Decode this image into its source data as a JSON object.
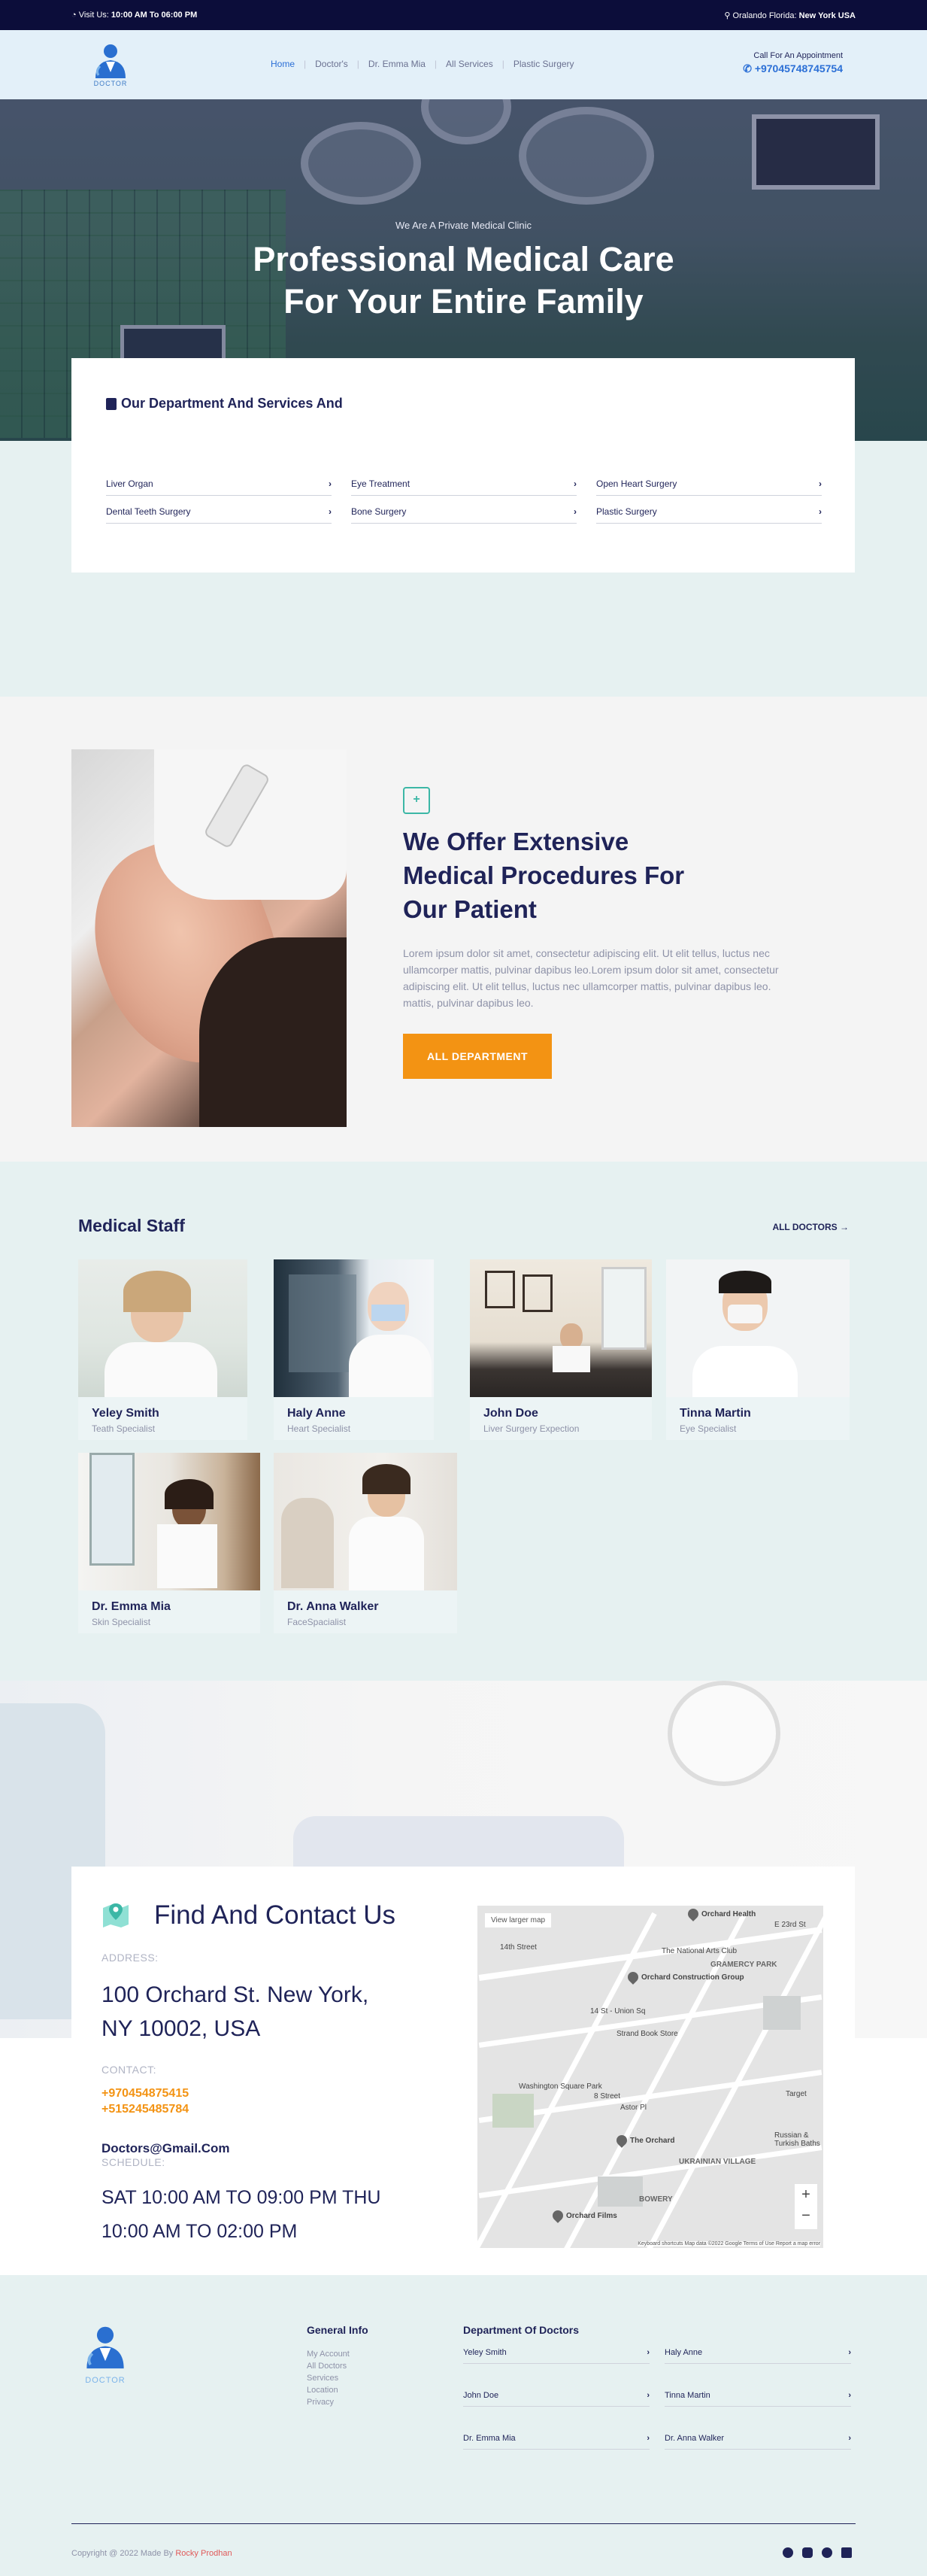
{
  "topbar": {
    "visit_label": "Visit Us:",
    "visit_hours": "10:00 AM To 06:00 PM",
    "location_label": "Oralando Florida:",
    "location_city": "New York USA"
  },
  "brand": {
    "logo_text": "DOCTOR"
  },
  "nav": {
    "items": [
      "Home",
      "Doctor's",
      "Dr. Emma Mia",
      "All Services",
      "Plastic Surgery"
    ]
  },
  "call": {
    "label": "Call For An Appointment",
    "phone": "+97045748745754"
  },
  "hero": {
    "subtitle": "We Are A Private Medical Clinic",
    "title_line1": "Professional Medical Care",
    "title_line2": "For Your Entire Family"
  },
  "departments": {
    "title": "Our Department And Services And",
    "items": [
      "Liver Organ",
      "Eye Treatment",
      "Open Heart Surgery",
      "Dental Teeth Surgery",
      "Bone Surgery",
      "Plastic Surgery"
    ]
  },
  "offer": {
    "title_line1": "We Offer Extensive",
    "title_line2": "Medical Procedures For",
    "title_line3": "Our Patient",
    "body": "Lorem ipsum dolor sit amet, consectetur adipiscing elit. Ut elit tellus, luctus nec ullamcorper mattis, pulvinar dapibus leo.Lorem ipsum dolor sit amet, consectetur adipiscing elit. Ut elit tellus, luctus nec ullamcorper mattis, pulvinar dapibus leo. mattis, pulvinar dapibus leo.",
    "button": "ALL DEPARTMENT"
  },
  "staff": {
    "title": "Medical Staff",
    "all_link": "ALL DOCTORS →",
    "members": [
      {
        "name": "Yeley Smith",
        "specialty": "Teath Specialist"
      },
      {
        "name": "Haly Anne",
        "specialty": "Heart Specialist"
      },
      {
        "name": "John Doe",
        "specialty": "Liver Surgery Expection"
      },
      {
        "name": "Tinna Martin",
        "specialty": "Eye Specialist"
      },
      {
        "name": "Dr. Emma Mia",
        "specialty": "Skin Specialist"
      },
      {
        "name": "Dr. Anna Walker",
        "specialty": "FaceSpacialist"
      }
    ]
  },
  "contact": {
    "title": "Find And Contact Us",
    "address_label": "ADDRESS:",
    "address_line1": "100 Orchard St. New York,",
    "address_line2": "NY 10002, USA",
    "contact_label": "CONTACT:",
    "phone1": "+970454875415",
    "phone2": "+515245485784",
    "email": "Doctors@Gmail.Com",
    "schedule_label": "SCHEDULE:",
    "schedule_line1": "SAT 10:00 AM TO 09:00 PM THU",
    "schedule_line2": "10:00 AM TO 02:00 PM"
  },
  "map": {
    "view_larger": "View larger map",
    "labels": [
      "Orchard Health",
      "The National Arts Club",
      "GRAMERCY PARK",
      "Orchard Construction Group",
      "Strand Book Store",
      "Washington Square Park",
      "The Orchard",
      "UKRAINIAN VILLAGE",
      "Orchard Films",
      "BOWERY",
      "14th Street",
      "E 23rd St",
      "Target",
      "Russian & Turkish Baths",
      "Astor Pl",
      "8 Street",
      "14 St - Union Sq"
    ],
    "attribution": "Keyboard shortcuts   Map data ©2022 Google   Terms of Use   Report a map error"
  },
  "footer": {
    "general_title": "General Info",
    "general_links": [
      "My Account",
      "All Doctors",
      "Services",
      "Location",
      "Privacy"
    ],
    "dept_title": "Department Of Doctors",
    "doctors": [
      "Yeley Smith",
      "Haly Anne",
      "John Doe",
      "Tinna Martin",
      "Dr. Emma Mia",
      "Dr. Anna Walker"
    ],
    "copyright": "Copyright @ 2022 Made By",
    "author": "Rocky Prodhan"
  },
  "colors": {
    "navy": "#1f2358",
    "accent": "#f39313",
    "link": "#2b6fd6",
    "teal": "#3cb7a6"
  }
}
